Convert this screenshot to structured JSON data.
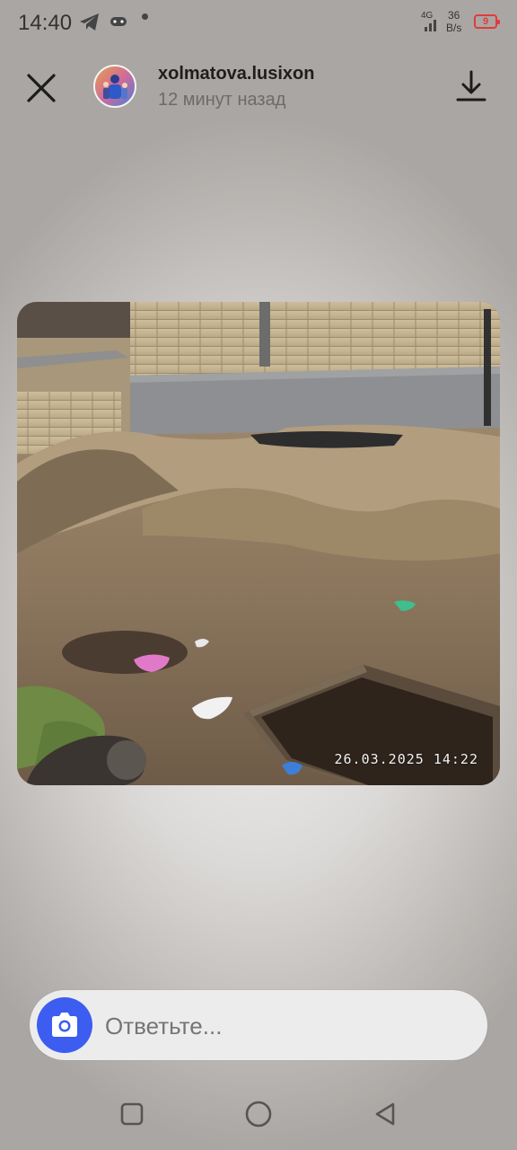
{
  "status_bar": {
    "time": "14:40",
    "network": "4G",
    "speed_value": "36",
    "speed_unit": "B/s",
    "battery": "9"
  },
  "header": {
    "username": "xolmatova.lusixon",
    "time_ago": "12 минут назад"
  },
  "photo": {
    "timestamp": "26.03.2025  14:22"
  },
  "reply": {
    "placeholder": "Ответьте..."
  },
  "icons": {
    "close": "close-icon",
    "download": "download-icon",
    "camera": "camera-icon",
    "telegram": "telegram-icon",
    "game": "gamepad-icon",
    "recents": "square-icon",
    "home": "circle-icon",
    "back": "triangle-back-icon"
  },
  "colors": {
    "accent": "#3d5cf0",
    "battery_low": "#e23b3b"
  }
}
